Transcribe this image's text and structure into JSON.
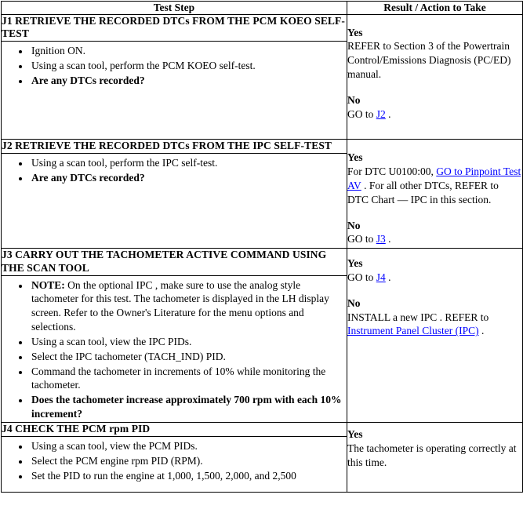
{
  "table": {
    "headers": {
      "step": "Test Step",
      "result": "Result / Action to Take"
    },
    "rows": [
      {
        "id": "j1",
        "title": "J1 RETRIEVE THE RECORDED DTCs FROM THE PCM KOEO SELF-TEST",
        "bullets": [
          "Ignition ON.",
          "Using a scan tool, perform the PCM KOEO self-test.",
          "Are any DTCs recorded?"
        ],
        "result": {
          "yes_label": "Yes",
          "yes_text_1": "REFER to Section 3 of the Powertrain Control/Emissions Diagnosis (PC/ED) manual.",
          "no_label": "No",
          "no_text_1": "GO to ",
          "no_link": "J2",
          "no_text_2": " ."
        }
      },
      {
        "id": "j2",
        "title": "J2 RETRIEVE THE RECORDED DTCs FROM THE IPC SELF-TEST",
        "bullets": [
          "Using a scan tool, perform the IPC self-test.",
          "Are any DTCs recorded?"
        ],
        "result": {
          "yes_label": "Yes",
          "yes_text_1": "For DTC U0100:00, ",
          "yes_link": "GO to Pinpoint Test AV",
          "yes_text_2": " . For all other DTCs, REFER to DTC Chart — IPC in this section.",
          "no_label": "No",
          "no_text_1": "GO to ",
          "no_link": "J3",
          "no_text_2": " ."
        }
      },
      {
        "id": "j3",
        "title": "J3 CARRY OUT THE TACHOMETER ACTIVE COMMAND USING THE SCAN TOOL",
        "bullets": [
          "NOTE:",
          "On the optional IPC , make sure to use the analog style tachometer for this test. The tachometer is displayed in the LH display screen. Refer to the Owner's Literature for the menu options and selections.",
          "Using a scan tool, view the IPC PIDs.",
          "Select the IPC tachometer (TACH_IND) PID.",
          "Command the tachometer in increments of 10% while monitoring the tachometer.",
          "Does the tachometer increase approximately 700 rpm with each 10% increment?"
        ],
        "result": {
          "yes_label": "Yes",
          "yes_text_1": "GO to ",
          "yes_link": "J4",
          "yes_text_2": " .",
          "no_label": "No",
          "no_text_1": "INSTALL a new IPC . REFER to ",
          "no_link": "Instrument Panel Cluster (IPC)",
          "no_text_2": " ."
        }
      },
      {
        "id": "j4",
        "title": "J4 CHECK THE PCM rpm PID",
        "bullets": [
          "Using a scan tool, view the PCM PIDs.",
          "Select the PCM engine rpm PID (RPM).",
          "Set the PID to run the engine at 1,000, 1,500, 2,000, and 2,500"
        ],
        "result": {
          "yes_label": "Yes",
          "yes_text_1": "The tachometer is operating correctly at this time."
        }
      }
    ]
  },
  "colors": {
    "link": "#0000ff",
    "text": "#000000",
    "border": "#000000",
    "background": "#ffffff"
  }
}
